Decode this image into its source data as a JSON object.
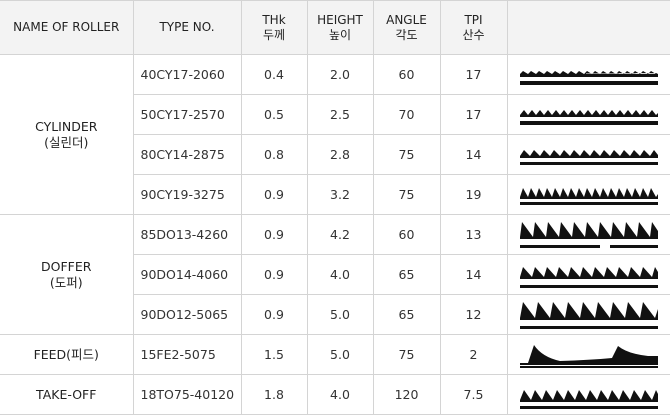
{
  "headers": {
    "name": "NAME OF ROLLER",
    "type": "TYPE NO.",
    "thk": "THk",
    "thk_ko": "두께",
    "height": "HEIGHT",
    "height_ko": "높이",
    "angle": "ANGLE",
    "angle_ko": "각도",
    "tpi": "TPI",
    "tpi_ko": "산수"
  },
  "groups": [
    {
      "name": "CYLINDER",
      "name_ko": "(실린더)"
    },
    {
      "name": "DOFFER",
      "name_ko": "(도퍼)"
    },
    {
      "name": "FEED(피드)"
    },
    {
      "name": "TAKE-OFF"
    }
  ],
  "rows": [
    {
      "type": "40CY17-2060",
      "thk": "0.4",
      "height": "2.0",
      "angle": "60",
      "tpi": "17",
      "profile": "cylinder-tooth-profile-icon"
    },
    {
      "type": "50CY17-2570",
      "thk": "0.5",
      "height": "2.5",
      "angle": "70",
      "tpi": "17",
      "profile": "cylinder-tooth-profile-icon"
    },
    {
      "type": "80CY14-2875",
      "thk": "0.8",
      "height": "2.8",
      "angle": "75",
      "tpi": "14",
      "profile": "cylinder-tooth-profile-icon"
    },
    {
      "type": "90CY19-3275",
      "thk": "0.9",
      "height": "3.2",
      "angle": "75",
      "tpi": "19",
      "profile": "cylinder-tooth-profile-icon"
    },
    {
      "type": "85DO13-4260",
      "thk": "0.9",
      "height": "4.2",
      "angle": "60",
      "tpi": "13",
      "profile": "doffer-tooth-profile-icon"
    },
    {
      "type": "90DO14-4060",
      "thk": "0.9",
      "height": "4.0",
      "angle": "65",
      "tpi": "14",
      "profile": "doffer-tooth-profile-icon"
    },
    {
      "type": "90DO12-5065",
      "thk": "0.9",
      "height": "5.0",
      "angle": "65",
      "tpi": "12",
      "profile": "doffer-tooth-profile-icon"
    },
    {
      "type": "15FE2-5075",
      "thk": "1.5",
      "height": "5.0",
      "angle": "75",
      "tpi": "2",
      "profile": "feed-tooth-profile-icon"
    },
    {
      "type": "18TO75-40120",
      "thk": "1.8",
      "height": "4.0",
      "angle": "120",
      "tpi": "7.5",
      "profile": "take-off-tooth-profile-icon"
    }
  ]
}
